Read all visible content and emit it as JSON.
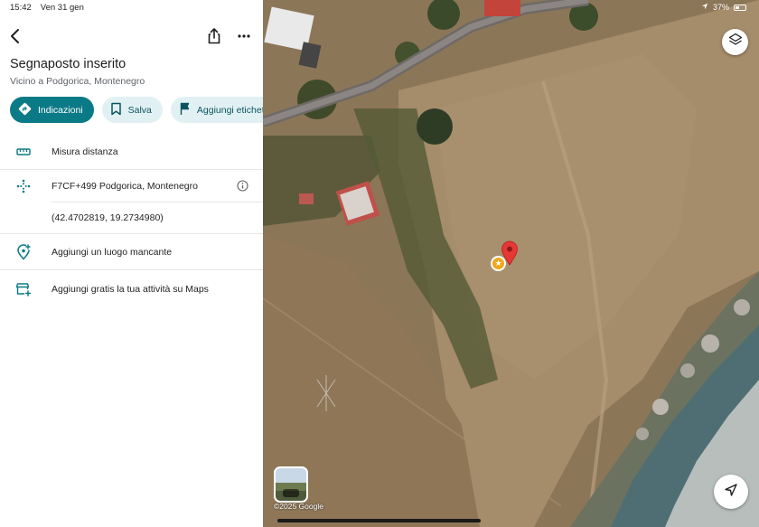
{
  "status": {
    "time": "15:42",
    "date": "Ven 31 gen",
    "battery": "37%"
  },
  "place": {
    "title": "Segnaposto inserito",
    "subtitle": "Vicino a Podgorica, Montenegro"
  },
  "actions": [
    {
      "label": "Indicazioni",
      "icon": "directions-icon"
    },
    {
      "label": "Salva",
      "icon": "bookmark-icon"
    },
    {
      "label": "Aggiungi etichet",
      "icon": "flag-icon"
    }
  ],
  "rows": {
    "measure": "Misura distanza",
    "plus_code": "F7CF+499 Podgorica, Montenegro",
    "coordinates": "(42.4702819, 19.2734980)",
    "add_place": "Aggiungi un luogo mancante",
    "add_business": "Aggiungi gratis la tua attività su Maps"
  },
  "map": {
    "copyright": "©2025 Google"
  },
  "colors": {
    "accent": "#0b7a87",
    "chip_bg": "#e1f1f3",
    "pin": "#e53935",
    "star": "#f2a71b"
  }
}
